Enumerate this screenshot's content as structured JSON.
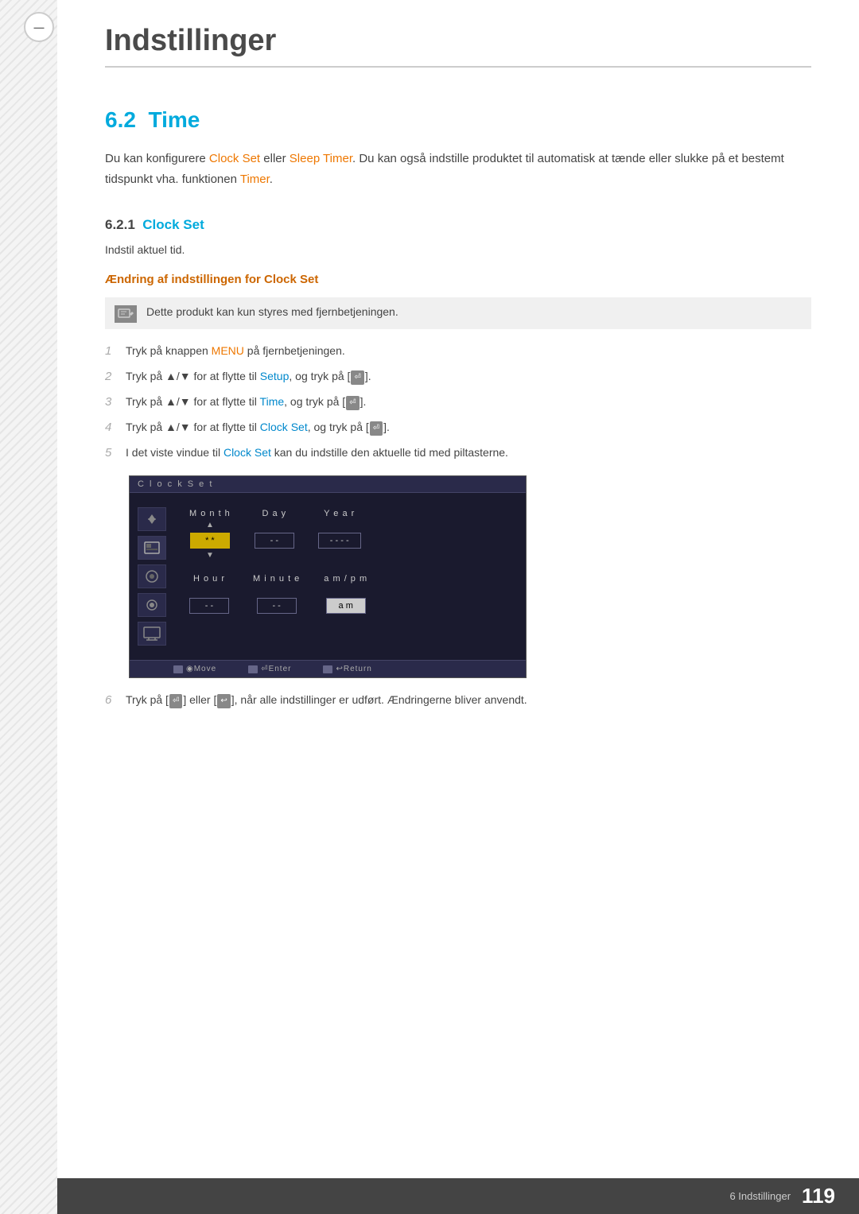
{
  "page": {
    "title": "Indstillinger",
    "chapter_number": "—",
    "footer_section": "6 Indstillinger",
    "footer_page": "119"
  },
  "section": {
    "number": "6.2",
    "title": "Time",
    "intro": "Du kan konfigurere Clock Set eller Sleep Timer. Du kan også indstille produktet til automatisk at tænde eller slukke på et bestemt tidspunkt vha. funktionen Timer.",
    "intro_highlight1": "Clock Set",
    "intro_highlight2": "Sleep Timer",
    "intro_highlight3": "Timer"
  },
  "subsection": {
    "number": "6.2.1",
    "title": "Clock Set",
    "body": "Indstil aktuel tid.",
    "change_heading": "Ændring af indstillingen for Clock Set"
  },
  "note": {
    "text": "Dette produkt kan kun styres med fjernbetjeningen."
  },
  "steps": [
    {
      "number": "1",
      "text": "Tryk på knappen MENU på fjernbetjeningen.",
      "highlight": "MENU"
    },
    {
      "number": "2",
      "text": "Tryk på ▲/▼ for at flytte til Setup, og tryk på [⏎].",
      "highlight": "Setup"
    },
    {
      "number": "3",
      "text": "Tryk på ▲/▼ for at flytte til Time, og tryk på [⏎].",
      "highlight": "Time"
    },
    {
      "number": "4",
      "text": "Tryk på ▲/▼ for at flytte til Clock Set, og tryk på [⏎].",
      "highlight": "Clock Set"
    },
    {
      "number": "5",
      "text": "I det viste vindue til Clock Set kan du indstille den aktuelle tid med piltasterne.",
      "highlight": "Clock Set"
    },
    {
      "number": "6",
      "text": "Tryk på [⏎] eller [↩], når alle indstillinger er udført. Ændringerne bliver anvendt.",
      "highlight": ""
    }
  ],
  "clock_set_ui": {
    "titlebar": "C l o c k S e t",
    "row1": {
      "fields": [
        {
          "label": "M o n t h",
          "value": "* *",
          "active": true
        },
        {
          "label": "D a y",
          "value": "- -",
          "active": false
        },
        {
          "label": "Y e a r",
          "value": "- - - -",
          "active": false
        }
      ]
    },
    "row2": {
      "fields": [
        {
          "label": "H o u r",
          "value": "- -",
          "active": false
        },
        {
          "label": "M i n u t e",
          "value": "- -",
          "active": false
        },
        {
          "label": "a m / p m",
          "value": "a m",
          "active": false,
          "white": true
        }
      ]
    },
    "bottom": [
      {
        "icon": "move",
        "label": "◉Move"
      },
      {
        "icon": "enter",
        "label": "⏎Enter"
      },
      {
        "icon": "return",
        "label": "↩Return"
      }
    ]
  }
}
